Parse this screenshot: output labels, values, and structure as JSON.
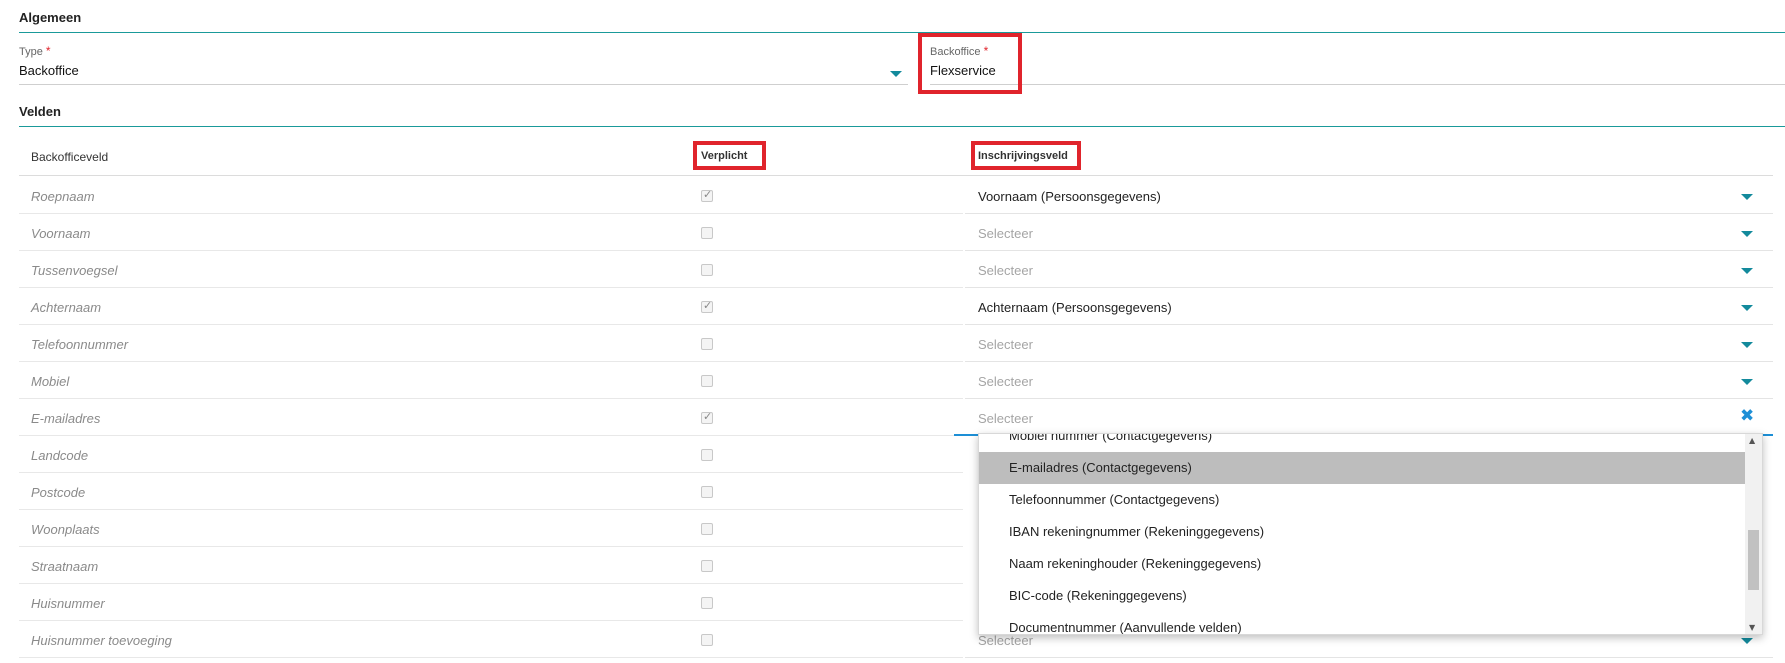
{
  "sections": {
    "algemeen": "Algemeen",
    "velden": "Velden"
  },
  "algemeen": {
    "type_label": "Type",
    "type_value": "Backoffice",
    "backoffice_label": "Backoffice",
    "backoffice_value": "Flexservice",
    "required_marker": "*"
  },
  "table": {
    "col_backofficeveld": "Backofficeveld",
    "col_verplicht": "Verplicht",
    "col_inschrijvingsveld": "Inschrijvingsveld",
    "placeholder": "Selecteer",
    "rows": [
      {
        "name": "Roepnaam",
        "required": true,
        "value": "Voornaam (Persoonsgegevens)"
      },
      {
        "name": "Voornaam",
        "required": false,
        "value": "Selecteer"
      },
      {
        "name": "Tussenvoegsel",
        "required": false,
        "value": "Selecteer"
      },
      {
        "name": "Achternaam",
        "required": true,
        "value": "Achternaam (Persoonsgegevens)"
      },
      {
        "name": "Telefoonnummer",
        "required": false,
        "value": "Selecteer"
      },
      {
        "name": "Mobiel",
        "required": false,
        "value": "Selecteer"
      },
      {
        "name": "E-mailadres",
        "required": true,
        "value": "Selecteer",
        "active": true
      },
      {
        "name": "Landcode",
        "required": false,
        "value": ""
      },
      {
        "name": "Postcode",
        "required": false,
        "value": ""
      },
      {
        "name": "Woonplaats",
        "required": false,
        "value": ""
      },
      {
        "name": "Straatnaam",
        "required": false,
        "value": ""
      },
      {
        "name": "Huisnummer",
        "required": false,
        "value": ""
      },
      {
        "name": "Huisnummer toevoeging",
        "required": false,
        "value": "Selecteer"
      }
    ]
  },
  "dropdown": {
    "options": [
      "Mobiel nummer (Contactgegevens)",
      "E-mailadres (Contactgegevens)",
      "Telefoonnummer (Contactgegevens)",
      "IBAN rekeningnummer (Rekeninggegevens)",
      "Naam rekeninghouder (Rekeninggegevens)",
      "BIC-code (Rekeninggegevens)",
      "Documentnummer (Aanvullende velden)"
    ],
    "highlighted": "E-mailadres (Contactgegevens)"
  },
  "icons": {
    "caret": "chevron-down-icon",
    "clear": "close-icon",
    "check": "check-icon"
  },
  "colors": {
    "accent": "#138a9c",
    "highlight_box": "#e0242c",
    "active_underline": "#1d8fd6"
  }
}
